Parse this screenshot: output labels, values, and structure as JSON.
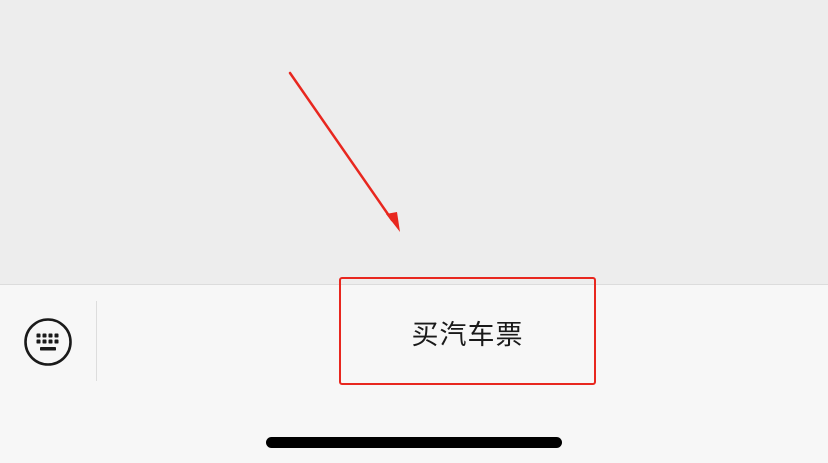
{
  "bottom_menu": {
    "keyboard_icon": "keyboard-icon",
    "item_label": "买汽车票"
  },
  "annotation": {
    "color": "#e8271f"
  }
}
